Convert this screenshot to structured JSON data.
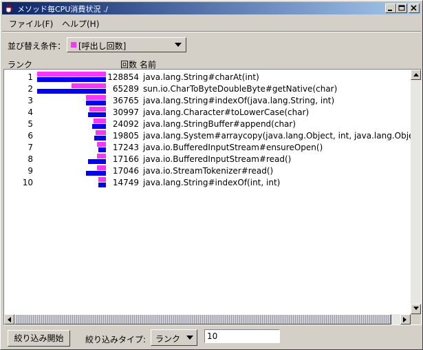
{
  "window": {
    "title": "メソッド毎CPU消費状況 ./",
    "icon": "java-cup-icon"
  },
  "menubar": [
    {
      "label": "ファイル(F)"
    },
    {
      "label": "ヘルプ(H)"
    }
  ],
  "sort": {
    "label": "並び替え条件：",
    "value": "[呼出し回数]",
    "swatch_color": "#ff33ff"
  },
  "columns": {
    "rank": "ランク",
    "count": "回数",
    "name": "名前"
  },
  "colors": {
    "bar_primary": "#ff33ff",
    "bar_secondary": "#0000ff"
  },
  "rows": [
    {
      "rank": "1",
      "count": "128854",
      "name": "java.lang.String#charAt(int)",
      "bar_magenta": 1.0,
      "bar_blue": 1.0
    },
    {
      "rank": "2",
      "count": "65289",
      "name": "sun.io.CharToByteDoubleByte#getNative(char)",
      "bar_magenta": 0.5,
      "bar_blue": 1.0
    },
    {
      "rank": "3",
      "count": "36765",
      "name": "java.lang.String#indexOf(java.lang.String, int)",
      "bar_magenta": 0.29,
      "bar_blue": 0.29
    },
    {
      "rank": "4",
      "count": "30997",
      "name": "java.lang.Character#toLowerCase(char)",
      "bar_magenta": 0.24,
      "bar_blue": 0.26
    },
    {
      "rank": "5",
      "count": "24092",
      "name": "java.lang.StringBuffer#append(char)",
      "bar_magenta": 0.18,
      "bar_blue": 0.2
    },
    {
      "rank": "6",
      "count": "19805",
      "name": "java.lang.System#arraycopy(java.lang.Object, int, java.lang.Object, int, int)",
      "bar_magenta": 0.15,
      "bar_blue": 0.17
    },
    {
      "rank": "7",
      "count": "17243",
      "name": "java.io.BufferedInputStream#ensureOpen()",
      "bar_magenta": 0.13,
      "bar_blue": 0.11
    },
    {
      "rank": "8",
      "count": "17166",
      "name": "java.io.BufferedInputStream#read()",
      "bar_magenta": 0.13,
      "bar_blue": 0.26
    },
    {
      "rank": "9",
      "count": "17046",
      "name": "java.io.StreamTokenizer#read()",
      "bar_magenta": 0.13,
      "bar_blue": 0.29
    },
    {
      "rank": "10",
      "count": "14749",
      "name": "java.lang.String#indexOf(int, int)",
      "bar_magenta": 0.11,
      "bar_blue": 0.11
    }
  ],
  "footer": {
    "filter_button": "絞り込み開始",
    "filter_type_label": "絞り込みタイプ:",
    "filter_type_value": "ランク",
    "count_value": "10"
  }
}
